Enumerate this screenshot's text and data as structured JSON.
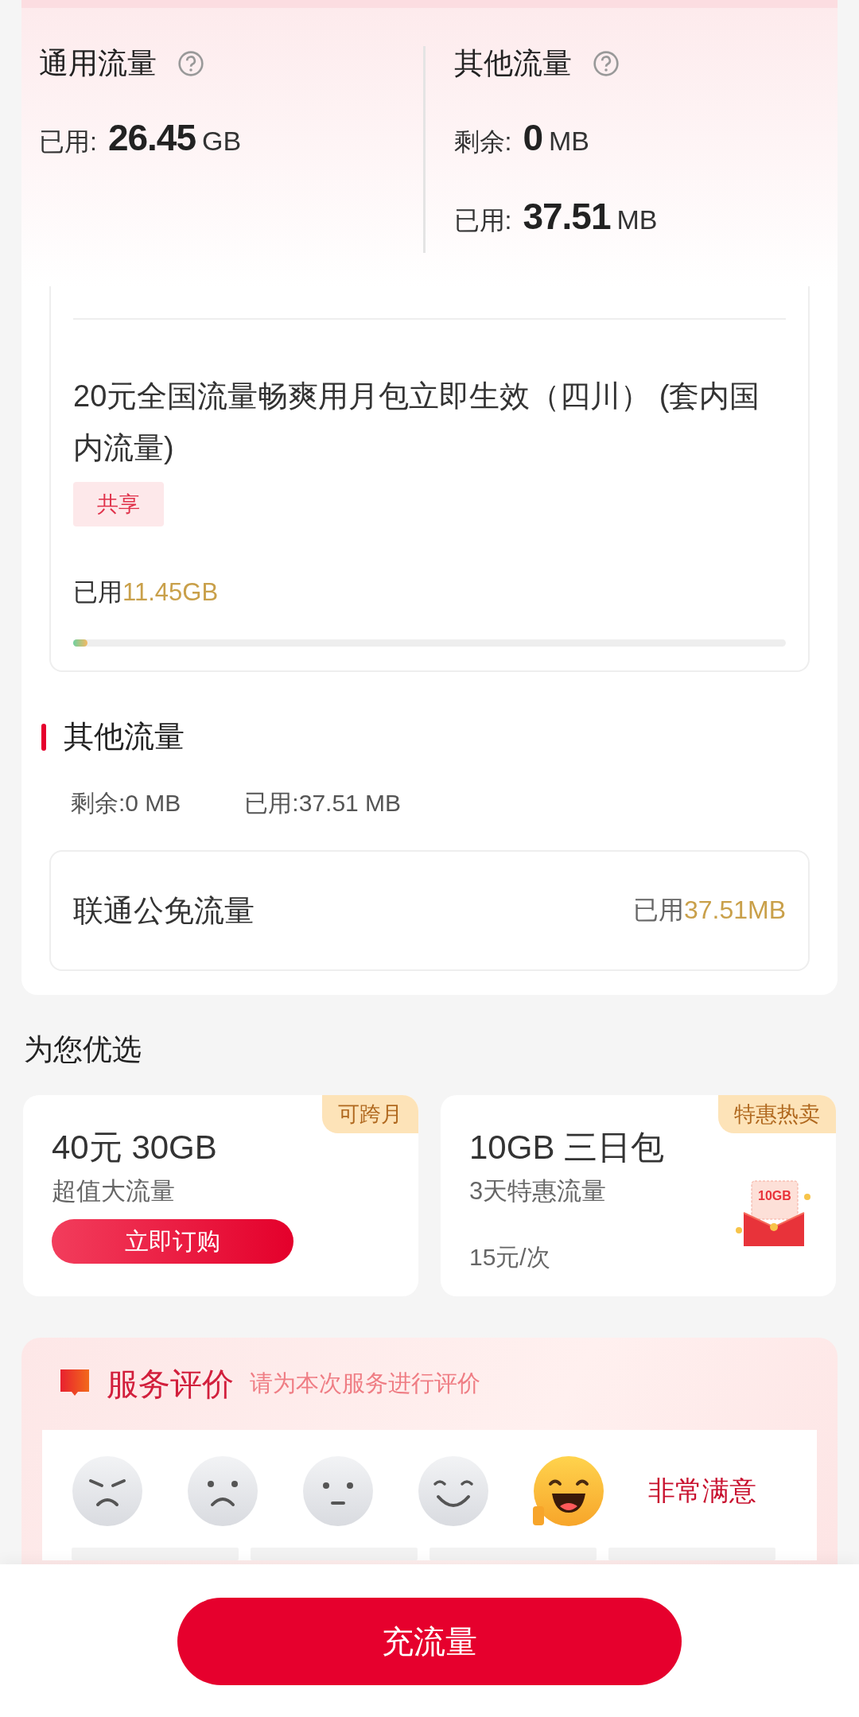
{
  "summary": [
    {
      "title": "通用流量",
      "rows": [
        {
          "label": "已用:",
          "value": "26.45",
          "unit": "GB"
        }
      ]
    },
    {
      "title": "其他流量",
      "rows": [
        {
          "label": "剩余:",
          "value": "0",
          "unit": "MB"
        },
        {
          "label": "已用:",
          "value": "37.51",
          "unit": "MB"
        }
      ]
    }
  ],
  "package": {
    "name": "20元全国流量畅爽用月包立即生效（四川） (套内国内流量)",
    "tag": "共享",
    "used_label": "已用",
    "used_value": "11.45GB",
    "level": 0.02
  },
  "other": {
    "title": "其他流量",
    "remaining": "剩余:0 MB",
    "used": "已用:37.51 MB",
    "items": [
      {
        "name": "联通公免流量",
        "used_label": "已用",
        "used_value": "37.51MB"
      }
    ]
  },
  "recommend": {
    "title": "为您优选",
    "products": [
      {
        "kind": "button",
        "badge": "可跨月",
        "title": "40元 30GB",
        "subtitle": "超值大流量",
        "action": "立即订购"
      },
      {
        "kind": "gift",
        "badge": "特惠热卖",
        "title": "10GB 三日包",
        "subtitle": "3天特惠流量",
        "price": "15元/次",
        "icon_text": "10GB"
      }
    ]
  },
  "evaluation": {
    "title": "服务评价",
    "hint": "请为本次服务进行评价",
    "selected_label": "非常满意",
    "faces": [
      {
        "kind": "angry",
        "selected": false
      },
      {
        "kind": "sad",
        "selected": false
      },
      {
        "kind": "neutral",
        "selected": false
      },
      {
        "kind": "smile",
        "selected": false
      },
      {
        "kind": "laugh",
        "selected": true
      }
    ]
  },
  "bottom_button": "充流量"
}
